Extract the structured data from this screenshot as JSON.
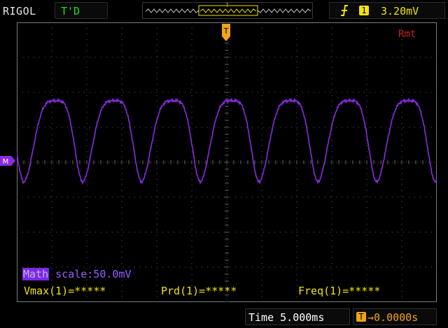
{
  "header": {
    "brand": "RIGOL",
    "trigger_status": "T'D",
    "trigger_channel": "1",
    "trigger_level": "3.20mV",
    "trigger_edge_icon": "rising-edge-icon"
  },
  "screen": {
    "remote_indicator": "Rmt",
    "trigger_marker_label": "T",
    "math_marker_label": "M",
    "grid_divisions": {
      "horizontal": 12,
      "vertical": 8
    },
    "colors": {
      "trace": "#8a2be2",
      "grid": "#5b5b5b",
      "trigger": "#f2a319",
      "measurement": "#f2e30a",
      "trigger_status": "#19e019",
      "remote": "#c82020"
    }
  },
  "math": {
    "tag": "Math",
    "scale": "scale:50.0mV"
  },
  "measurements": {
    "vmax": "Vmax(1)=*****",
    "period": "Prd(1)=*****",
    "frequency": "Freq(1)=*****"
  },
  "timebase": {
    "time": "Time 5.000ms",
    "offset": "0.0000s"
  }
}
